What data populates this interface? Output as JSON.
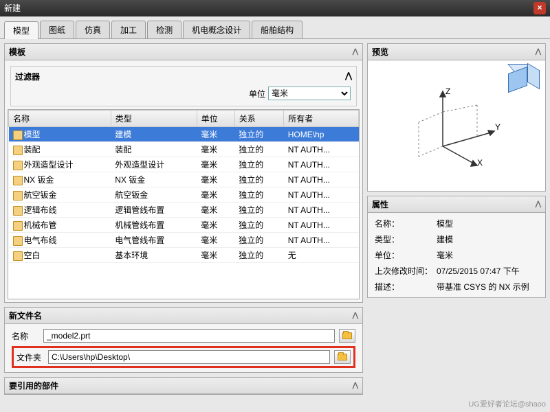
{
  "window": {
    "title": "新建",
    "close": "×"
  },
  "tabs": [
    "模型",
    "图纸",
    "仿真",
    "加工",
    "检测",
    "机电概念设计",
    "船舶结构"
  ],
  "active_tab": 0,
  "template": {
    "title": "模板",
    "filter": {
      "title": "过滤器",
      "unit_label": "单位",
      "unit_value": "毫米"
    },
    "columns": [
      "名称",
      "类型",
      "单位",
      "关系",
      "所有者"
    ],
    "rows": [
      {
        "n": "模型",
        "t": "建模",
        "u": "毫米",
        "r": "独立的",
        "o": "HOME\\hp",
        "sel": true
      },
      {
        "n": "装配",
        "t": "装配",
        "u": "毫米",
        "r": "独立的",
        "o": "NT AUTH..."
      },
      {
        "n": "外观造型设计",
        "t": "外观造型设计",
        "u": "毫米",
        "r": "独立的",
        "o": "NT AUTH..."
      },
      {
        "n": "NX 钣金",
        "t": "NX 钣金",
        "u": "毫米",
        "r": "独立的",
        "o": "NT AUTH..."
      },
      {
        "n": "航空钣金",
        "t": "航空钣金",
        "u": "毫米",
        "r": "独立的",
        "o": "NT AUTH..."
      },
      {
        "n": "逻辑布线",
        "t": "逻辑管线布置",
        "u": "毫米",
        "r": "独立的",
        "o": "NT AUTH..."
      },
      {
        "n": "机械布管",
        "t": "机械管线布置",
        "u": "毫米",
        "r": "独立的",
        "o": "NT AUTH..."
      },
      {
        "n": "电气布线",
        "t": "电气管线布置",
        "u": "毫米",
        "r": "独立的",
        "o": "NT AUTH..."
      },
      {
        "n": "空白",
        "t": "基本环境",
        "u": "毫米",
        "r": "独立的",
        "o": "无"
      }
    ]
  },
  "preview": {
    "title": "预览",
    "axes": {
      "x": "X",
      "y": "Y",
      "z": "Z"
    }
  },
  "properties": {
    "title": "属性",
    "rows": [
      {
        "l": "名称：",
        "v": "模型"
      },
      {
        "l": "类型：",
        "v": "建模"
      },
      {
        "l": "单位：",
        "v": "毫米"
      },
      {
        "l": "上次修改时间：",
        "v": "07/25/2015 07:47 下午"
      },
      {
        "l": "描述：",
        "v": "带基准 CSYS 的 NX 示例"
      }
    ]
  },
  "newfile": {
    "title": "新文件名",
    "name_label": "名称",
    "name_value": "_model2.prt",
    "folder_label": "文件夹",
    "folder_value": "C:\\Users\\hp\\Desktop\\"
  },
  "refparts": {
    "title": "要引用的部件"
  },
  "watermark": "UG爱好者论坛@shaoo"
}
